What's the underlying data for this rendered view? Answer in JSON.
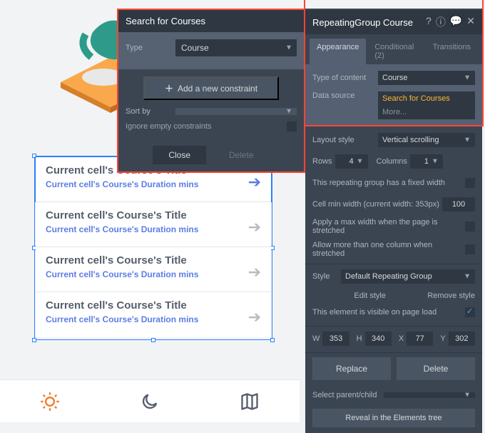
{
  "search_popup": {
    "title": "Search for Courses",
    "type_label": "Type",
    "type_value": "Course",
    "add_constraint": "Add a new constraint",
    "sort_by_label": "Sort by",
    "ignore_empty": "Ignore empty constraints",
    "close": "Close",
    "delete": "Delete"
  },
  "cells": [
    {
      "title": "Current cell's Course's Title",
      "sub": "Current cell's Course's Duration mins"
    },
    {
      "title": "Current cell's Course's Title",
      "sub": "Current cell's Course's Duration mins"
    },
    {
      "title": "Current cell's Course's Title",
      "sub": "Current cell's Course's Duration mins"
    },
    {
      "title": "Current cell's Course's Title",
      "sub": "Current cell's Course's Duration mins"
    }
  ],
  "panel": {
    "title": "RepeatingGroup Course",
    "tabs": {
      "appearance": "Appearance",
      "conditional": "Conditional (2)",
      "transitions": "Transitions"
    },
    "type_of_content_label": "Type of content",
    "type_of_content_value": "Course",
    "data_source_label": "Data source",
    "data_source_value": "Search for Courses",
    "more": "More...",
    "layout_style_label": "Layout style",
    "layout_style_value": "Vertical scrolling",
    "rows_label": "Rows",
    "rows_value": "4",
    "columns_label": "Columns",
    "columns_value": "1",
    "fixed_width": "This repeating group has a fixed width",
    "cell_min_width": "Cell min width (current width: 353px)",
    "cell_min_width_value": "100",
    "max_width": "Apply a max width when the page is stretched",
    "more_col": "Allow more than one column when stretched",
    "style_label": "Style",
    "style_value": "Default Repeating Group",
    "edit_style": "Edit style",
    "remove_style": "Remove style",
    "visible": "This element is visible on page load",
    "w_label": "W",
    "w_value": "353",
    "h_label": "H",
    "h_value": "340",
    "x_label": "X",
    "x_value": "77",
    "y_label": "Y",
    "y_value": "302",
    "replace": "Replace",
    "delete": "Delete",
    "select_parent_label": "Select parent/child",
    "reveal": "Reveal in the Elements tree"
  }
}
